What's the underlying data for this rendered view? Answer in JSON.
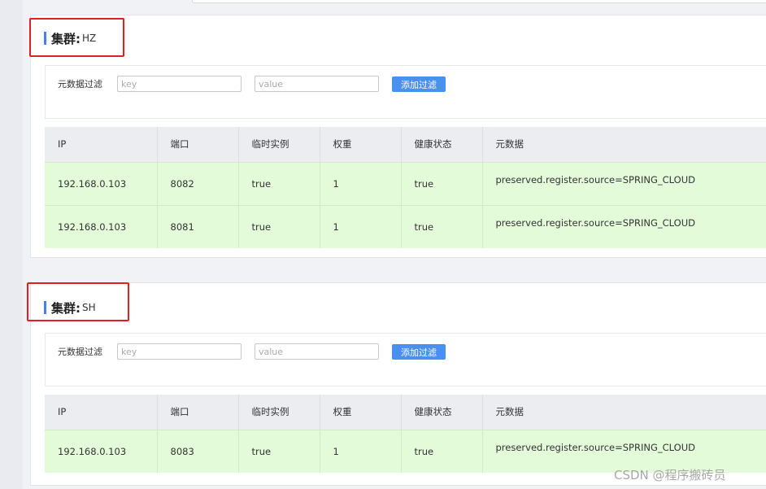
{
  "clusters": [
    {
      "label": "集群:",
      "name": "HZ",
      "filter": {
        "label": "元数据过滤",
        "key_placeholder": "key",
        "value_placeholder": "value",
        "button": "添加过滤"
      },
      "columns": [
        "IP",
        "端口",
        "临时实例",
        "权重",
        "健康状态",
        "元数据"
      ],
      "rows": [
        [
          "192.168.0.103",
          "8082",
          "true",
          "1",
          "true",
          "preserved.register.source=SPRING_CLOUD"
        ],
        [
          "192.168.0.103",
          "8081",
          "true",
          "1",
          "true",
          "preserved.register.source=SPRING_CLOUD"
        ]
      ]
    },
    {
      "label": "集群:",
      "name": "SH",
      "filter": {
        "label": "元数据过滤",
        "key_placeholder": "key",
        "value_placeholder": "value",
        "button": "添加过滤"
      },
      "columns": [
        "IP",
        "端口",
        "临时实例",
        "权重",
        "健康状态",
        "元数据"
      ],
      "rows": [
        [
          "192.168.0.103",
          "8083",
          "true",
          "1",
          "true",
          "preserved.register.source=SPRING_CLOUD"
        ]
      ]
    }
  ],
  "watermark": "CSDN @程序搬砖员",
  "colors": {
    "accent": "#4a7ee8",
    "button": "#4a90f0",
    "highlight": "#e02020",
    "healthy_row": "#e4fbda"
  }
}
